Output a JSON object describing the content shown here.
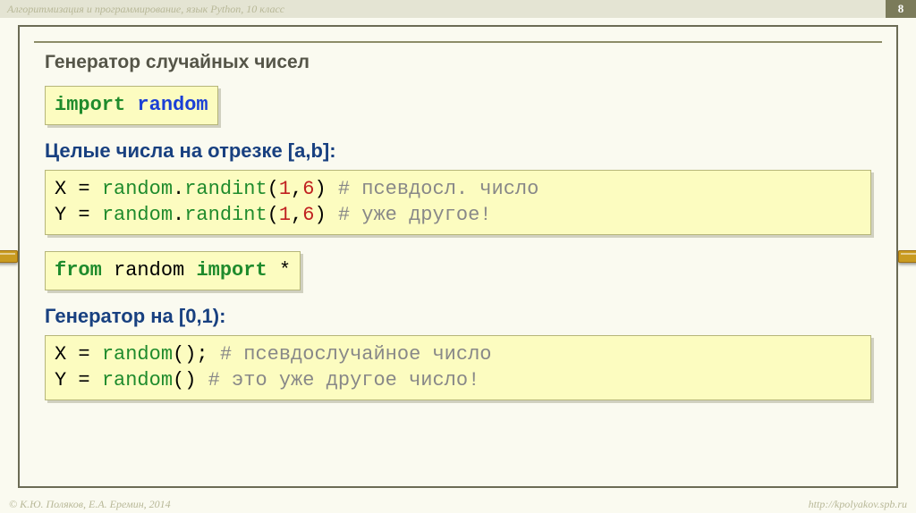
{
  "meta": {
    "course_title": "Алгоритмизация и программирование, язык Python, 10 класс",
    "page_number": "8",
    "copyright": "© К.Ю. Поляков, Е.А. Еремин, 2014",
    "url": "http://kpolyakov.spb.ru"
  },
  "title": "Генератор случайных чисел",
  "code1": {
    "kw_import": "import",
    "mod": "random"
  },
  "sub1": "Целые числа на отрезке [a,b]:",
  "code2": {
    "l1_var": "X",
    "l1_eq": " = ",
    "l1_mod": "random",
    "l1_dot": ".",
    "l1_fn": "randint",
    "l1_open": "(",
    "l1_a": "1",
    "l1_comma": ",",
    "l1_b": "6",
    "l1_close": ")",
    "l1_sp": " ",
    "l1_cm": "# псевдосл. число",
    "l2_var": "Y",
    "l2_cm": "# уже другое!"
  },
  "code3": {
    "kw_from": "from",
    "mod": "random",
    "kw_import": "import",
    "star": "*"
  },
  "sub2": "Генератор на [0,1):",
  "code4": {
    "l1_var": "X",
    "l1_eq": " = ",
    "l1_fn": "random",
    "l1_par": "();",
    "l1_sp": " ",
    "l1_cm": "# псевдослучайное число",
    "l2_var": "Y",
    "l2_par": "()",
    "l2_sp": "   ",
    "l2_cm": "# это уже другое число!"
  }
}
